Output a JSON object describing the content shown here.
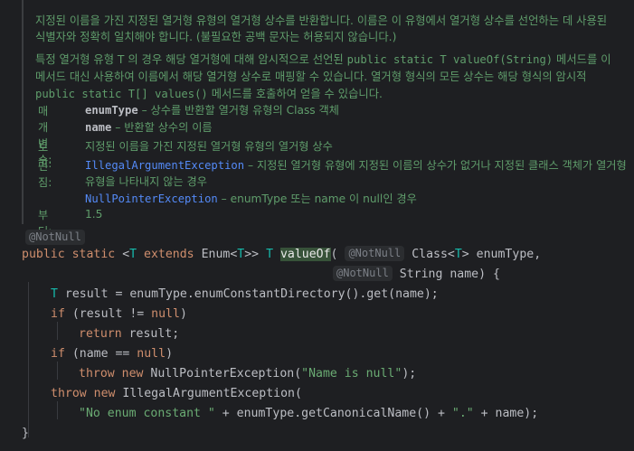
{
  "javadoc": {
    "p1": "지정된 이름을 가진 지정된 열거형 유형의 열거형 상수를 반환합니다. 이름은 이 유형에서 열거형 상수를 선언하는 데 사용된 식별자와 정확히 일치해야 합니다. (불필요한 공백 문자는 허용되지 않습니다.)",
    "p2_a": "특정 열거형 유형 T 의 경우 해당 열거형에 대해 암시적으로 선언된 ",
    "p2_code1": "public static T valueOf(String)",
    "p2_b": " 메서드를 이 메서드 대신 사용하여 이름에서 해당 열거형 상수로 매핑할 수 있습니다. 열거형 형식의 모든 상수는 해당 형식의 암시적 ",
    "p2_code2": "public static T[] values()",
    "p2_c": " 메서드를 호출하여 얻을 수 있습니다.",
    "params_label": "매개변수:",
    "param1_name": "enumType",
    "param1_desc": " – 상수를 반환할 열거형 유형의 Class 객체",
    "param2_name": "name",
    "param2_desc": " – 반환할 상수의 이름",
    "returns_label": "보고:",
    "returns_desc": "지정된 이름을 가진 지정된 열거형 유형의 열거형 상수",
    "throws_label": "던짐:",
    "throws1_name": "IllegalArgumentException",
    "throws1_desc": " – 지정된 열거형 유형에 지정된 이름의 상수가 없거나 지정된 클래스 객체가 열거형 유형을 나타내지 않는 경우",
    "throws2_name": "NullPointerException",
    "throws2_desc": " – enumType 또는 name 이 null인 경우",
    "since_label": "부터:",
    "since_value": "1.5"
  },
  "code": {
    "annotation": "@NotNull",
    "l1_public": "public",
    "l1_static": "static",
    "l1_lt": "<",
    "l1_T": "T",
    "l1_extends": "extends",
    "l1_enum": "Enum<",
    "l1_T2": "T",
    "l1_gt": ">> ",
    "l1_T3": "T",
    "l1_method": "valueOf",
    "l1_paren": "(",
    "l1_ann": "@NotNull",
    "l1_class": "Class<",
    "l1_T4": "T",
    "l1_rest": "> enumType,",
    "l2_ann": "@NotNull",
    "l2_rest": "String name) {",
    "l3_T": "T",
    "l3_rest": " result = enumType.enumConstantDirectory().get(name);",
    "l4_if": "if",
    "l4_a": " (result != ",
    "l4_null": "null",
    "l4_b": ")",
    "l5_return": "return",
    "l5_rest": " result;",
    "l6_if": "if",
    "l6_a": " (name == ",
    "l6_null": "null",
    "l6_b": ")",
    "l7_throw": "throw",
    "l7_new": "new",
    "l7_a": " NullPointerException(",
    "l7_str": "\"Name is null\"",
    "l7_b": ");",
    "l8_throw": "throw",
    "l8_new": "new",
    "l8_a": " IllegalArgumentException(",
    "l9_str": "\"No enum constant \"",
    "l9_a": " + enumType.getCanonicalName() + ",
    "l9_str2": "\".\"",
    "l9_b": " + name);",
    "l10": "}"
  },
  "colors": {
    "background": "#1e1f22",
    "doc_text": "#5f9d6b",
    "keyword": "#cf8e6d",
    "link": "#548af7",
    "string": "#6aab73",
    "type_param": "#16baac"
  }
}
